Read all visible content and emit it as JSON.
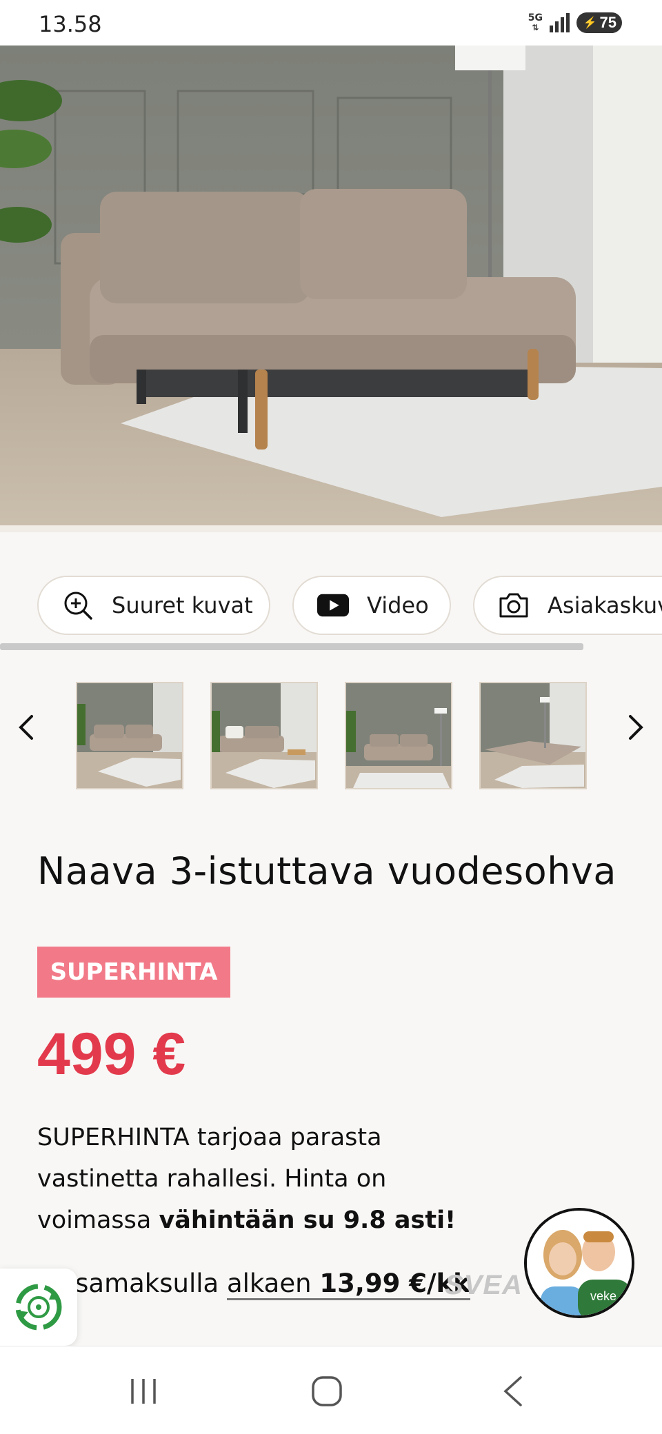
{
  "status_bar": {
    "time": "13.58",
    "network": "5G",
    "battery": "75"
  },
  "hero": {
    "alt_icon": "sofa-hero-image"
  },
  "media_chips": [
    {
      "label": "Suuret kuvat",
      "icon": "zoom-in-icon"
    },
    {
      "label": "Video",
      "icon": "youtube-play-icon"
    },
    {
      "label": "Asiakaskuv",
      "icon": "camera-icon"
    }
  ],
  "thumbnails": {
    "prev_icon": "chevron-left-icon",
    "next_icon": "chevron-right-icon",
    "count": 4
  },
  "product": {
    "title": "Naava 3-istuttava vuodesohva",
    "badge": "SUPERHINTA",
    "price": "499 €",
    "desc_line1": "SUPERHINTA tarjoaa parasta",
    "desc_line2": "vastinetta rahallesi. Hinta on",
    "desc_line3_plain": "voimassa ",
    "desc_line3_bold": "vähintään su 9.8 asti!",
    "installment_prefix": "Osamaksulla ",
    "installment_link": "alkaen",
    "installment_amount": "13,99 €/kk",
    "financing_brand": "SVEA"
  },
  "colors": {
    "accent_red": "#e23a4c",
    "badge_pink": "#f27a88",
    "background": "#f8f7f5"
  }
}
